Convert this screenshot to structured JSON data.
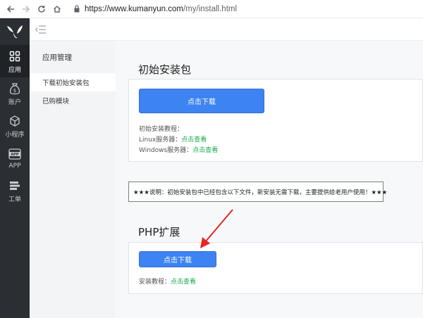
{
  "browser": {
    "url_host": "https://www.kumanyun.com",
    "url_path": "/my/install.html",
    "back_icon": "arrow-left-icon",
    "forward_icon": "arrow-right-icon",
    "reload_icon": "reload-icon",
    "home_icon": "home-icon",
    "lock_icon": "lock-icon"
  },
  "sidebar": {
    "logo_icon": "brand-logo-icon",
    "items": [
      {
        "label": "应用",
        "icon": "grid-icon",
        "active": true
      },
      {
        "label": "账户",
        "icon": "money-bag-icon",
        "active": false
      },
      {
        "label": "小程序",
        "icon": "cube-icon",
        "active": false
      },
      {
        "label": "APP",
        "icon": "app-icon",
        "active": false
      },
      {
        "label": "工单",
        "icon": "ticket-icon",
        "active": false
      }
    ]
  },
  "header": {
    "menu_toggle_icon": "menu-collapse-icon"
  },
  "subnav": {
    "title": "应用管理",
    "items": [
      {
        "label": "下载初始安装包",
        "active": true
      },
      {
        "label": "已购模块",
        "active": false
      }
    ]
  },
  "sections": {
    "install": {
      "title": "初始安装包",
      "button": "点击下载",
      "tutorial_label": "初始安装教程：",
      "linux_label": "Linux服务器：",
      "linux_link": "点击查看",
      "windows_label": "Windows服务器：",
      "windows_link": "点击查看"
    },
    "notice": {
      "text": "★★★说明：初始安装包中已经包含以下文件，新安装无需下载，主要提供给老用户使用！★★★"
    },
    "php": {
      "title": "PHP扩展",
      "button": "点击下载",
      "tutorial_label": "安装教程：",
      "tutorial_link": "点击查看"
    }
  },
  "colors": {
    "sidebar_bg": "#2b2f33",
    "primary_button": "#3d83f2",
    "link_green": "#1aa94c",
    "annotation_arrow": "#e8251f"
  }
}
